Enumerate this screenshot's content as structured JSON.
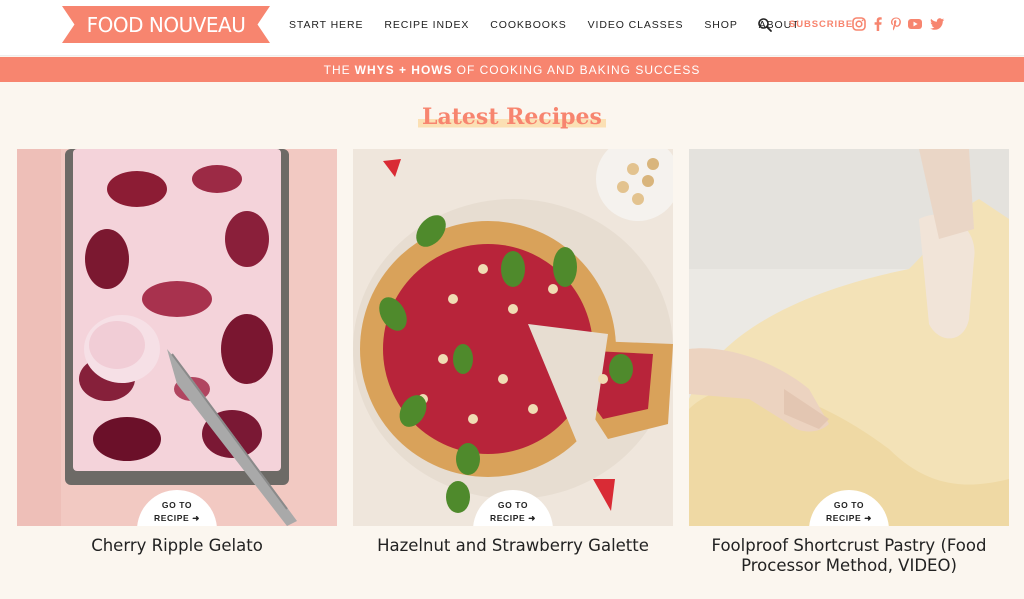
{
  "header": {
    "logo": "FOOD NOUVEAU",
    "nav": [
      "START HERE",
      "RECIPE INDEX",
      "COOKBOOKS",
      "VIDEO CLASSES",
      "SHOP",
      "ABOUT"
    ],
    "subscribe": "SUBSCRIBE",
    "icons": [
      "search-icon",
      "instagram-icon",
      "facebook-icon",
      "pinterest-icon",
      "youtube-icon",
      "twitter-icon"
    ],
    "accent_color": "#f7856f"
  },
  "banner": {
    "pre": "THE",
    "bold": "WHYS + HOWS",
    "post": "OF COOKING AND BAKING SUCCESS"
  },
  "section": {
    "title": "Latest Recipes"
  },
  "cards": [
    {
      "button_line1": "GO TO",
      "button_line2": "RECIPE ➜",
      "title": "Cherry Ripple Gelato"
    },
    {
      "button_line1": "GO TO",
      "button_line2": "RECIPE ➜",
      "title": "Hazelnut and Strawberry Galette"
    },
    {
      "button_line1": "GO TO",
      "button_line2": "RECIPE ➜",
      "title": "Foolproof Shortcrust Pastry (Food Processor Method, VIDEO)"
    }
  ]
}
